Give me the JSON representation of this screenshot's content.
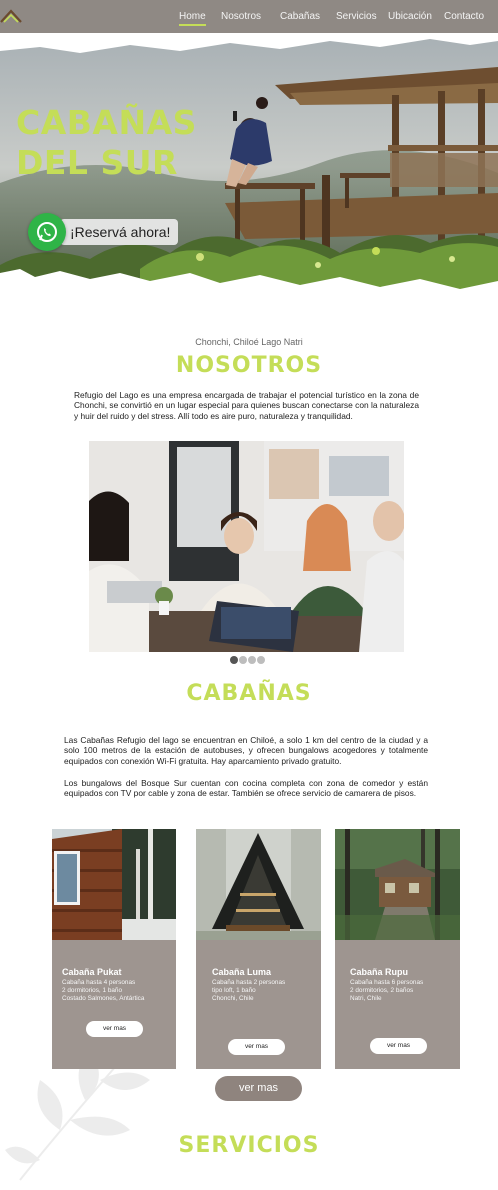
{
  "nav": {
    "logo_icon": "mountain-roof-logo-icon",
    "items": [
      {
        "label": "Home",
        "active": true
      },
      {
        "label": "Nosotros",
        "active": false
      },
      {
        "label": "Cabañas",
        "active": false
      },
      {
        "label": "Servicios",
        "active": false
      },
      {
        "label": "Ubicación",
        "active": false
      },
      {
        "label": "Contacto",
        "active": false
      }
    ]
  },
  "hero": {
    "title_line1": "CABAÑAS",
    "title_line2": "DEL SUR",
    "cta_label": "¡Reservá ahora!",
    "cta_icon": "whatsapp-icon"
  },
  "nosotros": {
    "location": "Chonchi, Chiloé Lago Natri",
    "title": "NOSOTROS",
    "paragraph": "Refugio del Lago es una empresa encargada de trabajar el potencial turístico en la zona de Chonchi, se convirtió en un lugar especial para quienes buscan conectarse con la naturaleza y huir del ruido y del stress. Allí todo es aire puro, naturaleza y tranquilidad.",
    "carousel": {
      "count": 4,
      "active": 0
    }
  },
  "cabanas": {
    "title": "CABAÑAS",
    "paragraph1": "Las Cabañas Refugio del lago se encuentran en Chiloé, a solo 1 km del centro de la ciudad y a solo 100 metros de la estación de autobuses, y ofrecen bungalows acogedores y totalmente equipados con conexión Wi-Fi gratuita. Hay aparcamiento privado gratuito.",
    "paragraph2": "Los bungalows del Bosque Sur cuentan con cocina completa con zona de comedor y están equipados con TV por cable y zona de estar. También se ofrece servicio de camarera de pisos.",
    "cards": [
      {
        "title": "Cabaña Pukat",
        "lines": [
          "Cabaña hasta 4 personas",
          "2 dormitorios, 1 baño",
          "Costado Salmones, Antártica"
        ],
        "button": "ver mas"
      },
      {
        "title": "Cabaña Luma",
        "lines": [
          "Cabaña hasta 2 personas",
          "tipo loft, 1 baño",
          "Chonchi, Chile"
        ],
        "button": "ver mas"
      },
      {
        "title": "Cabaña Rupu",
        "lines": [
          "Cabaña hasta 6 personas",
          "2 dormitorios, 2 baños",
          "Natri, Chile"
        ],
        "button": "ver mas"
      }
    ],
    "more_button": "ver mas"
  },
  "servicios": {
    "title": "SERVICIOS"
  },
  "colors": {
    "accent": "#c4dd58",
    "nav_bg": "#8f8984",
    "card_bg": "#9e9590",
    "button_bg": "#8f847e",
    "whatsapp": "#2fb447"
  }
}
